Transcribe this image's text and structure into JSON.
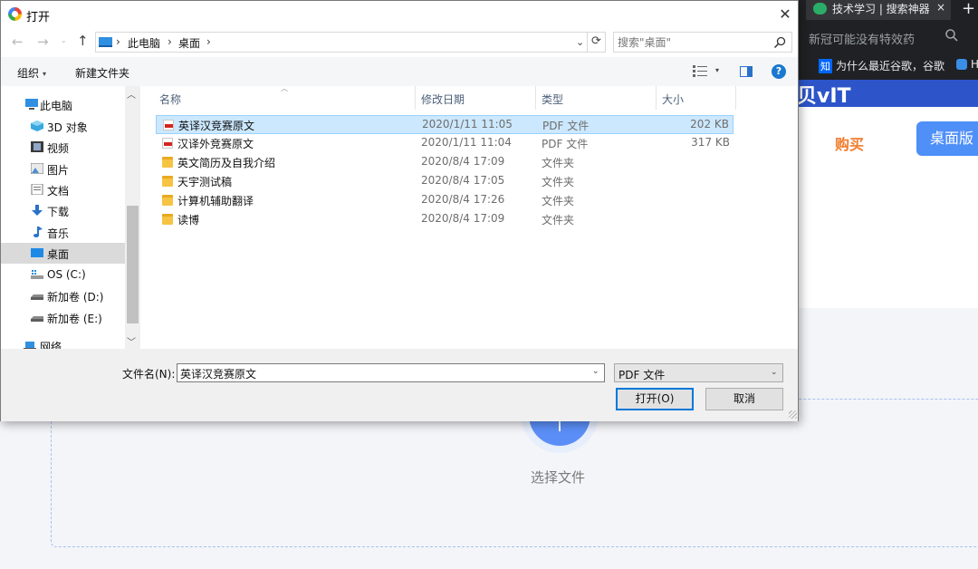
{
  "background": {
    "browser_tab_label": "技术学习 | 搜索神器",
    "browser_tab_close": "×",
    "new_tab": "+",
    "omnibox_text": "新冠可能没有特效药",
    "bookmark_zhi_badge": "知",
    "bookmark_zhi_label": "为什么最近谷歌，谷歌",
    "bookmark_truncated": "H",
    "banner_fragment": "贝vIT",
    "buy_label": "购买",
    "desktop_label": "桌面版",
    "upload_label": "选择文件",
    "colors": {
      "accent": "#4e8ff8",
      "buy": "#f07b2c",
      "banner": "#2d55c9"
    }
  },
  "dialog": {
    "title": "打开",
    "close": "✕",
    "nav": {
      "back": "←",
      "forward": "→",
      "dropdown": "⌄",
      "up": "↑"
    },
    "address": {
      "crumbs": [
        "此电脑",
        "桌面"
      ],
      "separator": "›",
      "dropdown": "⌄",
      "refresh": "⟳"
    },
    "search": {
      "placeholder": "搜索\"桌面\""
    },
    "toolbar": {
      "organize": "组织",
      "organize_caret": "▾",
      "new_folder": "新建文件夹",
      "view_caret": "▾",
      "help": "?"
    },
    "nav_pane": [
      {
        "label": "此电脑",
        "icon": "this-pc-icon"
      },
      {
        "label": "3D 对象",
        "icon": "3d-objects-icon"
      },
      {
        "label": "视频",
        "icon": "videos-icon"
      },
      {
        "label": "图片",
        "icon": "pictures-icon"
      },
      {
        "label": "文档",
        "icon": "documents-icon"
      },
      {
        "label": "下载",
        "icon": "downloads-icon"
      },
      {
        "label": "音乐",
        "icon": "music-icon"
      },
      {
        "label": "桌面",
        "icon": "desktop-icon",
        "selected": true
      },
      {
        "label": "OS (C:)",
        "icon": "drive-c-icon"
      },
      {
        "label": "新加卷 (D:)",
        "icon": "drive-icon"
      },
      {
        "label": "新加卷 (E:)",
        "icon": "drive-icon"
      },
      {
        "label": "网络",
        "icon": "network-icon"
      }
    ],
    "scroll": {
      "up": "︿",
      "down": "﹀"
    },
    "columns": {
      "name": "名称",
      "date": "修改日期",
      "type": "类型",
      "size": "大小",
      "sort_caret": "︿"
    },
    "files": [
      {
        "name": "英译汉竞赛原文",
        "date": "2020/1/11 11:05",
        "type": "PDF 文件",
        "size": "202 KB",
        "kind": "pdf",
        "selected": true
      },
      {
        "name": "汉译外竞赛原文",
        "date": "2020/1/11 11:04",
        "type": "PDF 文件",
        "size": "317 KB",
        "kind": "pdf"
      },
      {
        "name": "英文简历及自我介绍",
        "date": "2020/8/4 17:09",
        "type": "文件夹",
        "size": "",
        "kind": "folder"
      },
      {
        "name": "天宇测试稿",
        "date": "2020/8/4 17:05",
        "type": "文件夹",
        "size": "",
        "kind": "folder"
      },
      {
        "name": "计算机辅助翻译",
        "date": "2020/8/4 17:26",
        "type": "文件夹",
        "size": "",
        "kind": "folder"
      },
      {
        "name": "读博",
        "date": "2020/8/4 17:09",
        "type": "文件夹",
        "size": "",
        "kind": "folder"
      }
    ],
    "filename_label": "文件名(N):",
    "filename_value": "英译汉竞赛原文",
    "filename_dd": "⌄",
    "filetype_value": "PDF 文件",
    "filetype_dd": "⌄",
    "open_label": "打开(O)",
    "cancel_label": "取消"
  }
}
